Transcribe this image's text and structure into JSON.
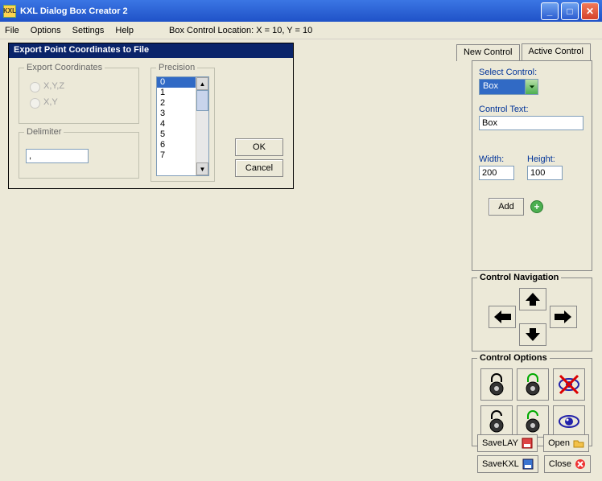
{
  "window": {
    "title": "KXL Dialog Box Creator 2",
    "app_icon_text": "KXL"
  },
  "menu": {
    "file": "File",
    "options": "Options",
    "settings": "Settings",
    "help": "Help",
    "status": "Box Control Location: X = 10, Y = 10"
  },
  "dialog": {
    "title": "Export Point Coordinates to File",
    "export_group": "Export Coordinates",
    "radio_xyz": "X,Y,Z",
    "radio_xy": "X,Y",
    "precision_group": "Precision",
    "precision_items": [
      "0",
      "1",
      "2",
      "3",
      "4",
      "5",
      "6",
      "7"
    ],
    "precision_selected": "0",
    "delimiter_group": "Delimiter",
    "delimiter_value": ",",
    "ok": "OK",
    "cancel": "Cancel"
  },
  "tabs": {
    "new": "New Control",
    "active": "Active Control"
  },
  "newcontrol": {
    "select_label": "Select Control:",
    "select_value": "Box",
    "text_label": "Control Text:",
    "text_value": "Box",
    "width_label": "Width:",
    "width_value": "200",
    "height_label": "Height:",
    "height_value": "100",
    "add": "Add"
  },
  "nav": {
    "title": "Control Navigation"
  },
  "opts": {
    "title": "Control Options"
  },
  "bottom": {
    "savelay": "SaveLAY",
    "open": "Open",
    "savekxl": "SaveKXL",
    "close": "Close"
  }
}
